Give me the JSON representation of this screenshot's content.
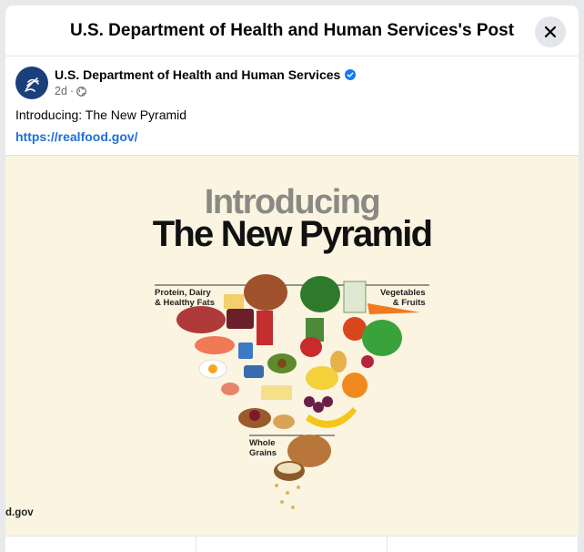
{
  "dialog": {
    "title": "U.S. Department of Health and Human Services's Post"
  },
  "post": {
    "author": "U.S. Department of Health and Human Services",
    "verified": true,
    "time": "2d",
    "separator": "·",
    "text": "Introducing: The New Pyramid",
    "link": "https://realfood.gov/"
  },
  "image": {
    "heading_top": "Introducing",
    "heading_main": "The New Pyramid",
    "label_left": [
      "Protein, Dairy",
      "& Healthy Fats"
    ],
    "label_right": [
      "Vegetables",
      "& Fruits"
    ],
    "label_bottom": [
      "Whole",
      "Grains"
    ],
    "watermark": "d.gov"
  },
  "colors": {
    "brand_blue": "#216fdb",
    "verified_blue": "#1877f2",
    "image_bg": "#faf4e1"
  }
}
